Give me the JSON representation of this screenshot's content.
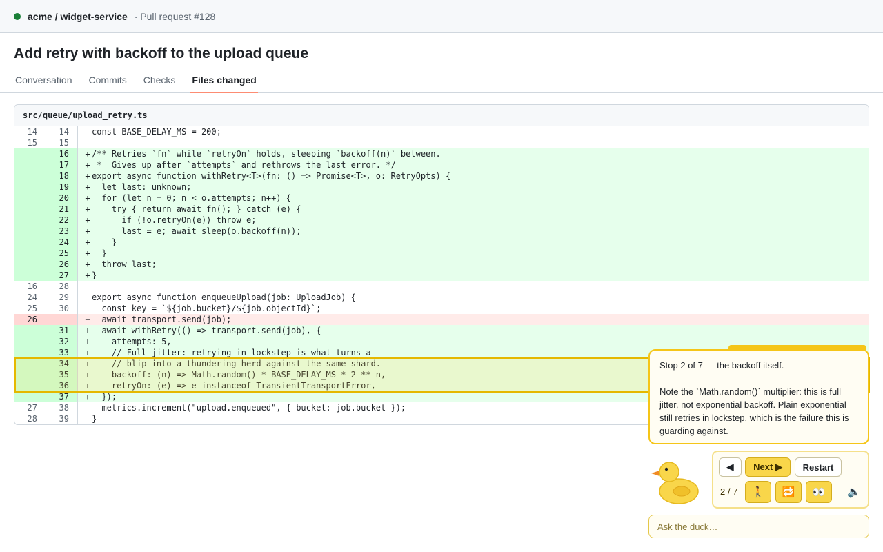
{
  "header": {
    "repo": "acme / widget-service",
    "pr_ref": "· Pull request #128",
    "status_color": "#1a7f37"
  },
  "pr_title": "Add retry with backoff to the upload queue",
  "tabs": [
    {
      "label": "Conversation",
      "active": false
    },
    {
      "label": "Commits",
      "active": false
    },
    {
      "label": "Checks",
      "active": false
    },
    {
      "label": "Files changed",
      "active": true
    }
  ],
  "file": {
    "path": "src/queue/upload_retry.ts",
    "lines": [
      {
        "type": "ctx",
        "old": "14",
        "new": "14",
        "sign": "",
        "code": "const BASE_DELAY_MS = 200;"
      },
      {
        "type": "ctx",
        "old": "15",
        "new": "15",
        "sign": "",
        "code": ""
      },
      {
        "type": "add",
        "old": "",
        "new": "16",
        "sign": "+",
        "code": "/** Retries `fn` while `retryOn` holds, sleeping `backoff(n)` between."
      },
      {
        "type": "add",
        "old": "",
        "new": "17",
        "sign": "+",
        "code": " *  Gives up after `attempts` and rethrows the last error. */"
      },
      {
        "type": "add",
        "old": "",
        "new": "18",
        "sign": "+",
        "code": "export async function withRetry<T>(fn: () => Promise<T>, o: RetryOpts) {"
      },
      {
        "type": "add",
        "old": "",
        "new": "19",
        "sign": "+",
        "code": "  let last: unknown;"
      },
      {
        "type": "add",
        "old": "",
        "new": "20",
        "sign": "+",
        "code": "  for (let n = 0; n < o.attempts; n++) {"
      },
      {
        "type": "add",
        "old": "",
        "new": "21",
        "sign": "+",
        "code": "    try { return await fn(); } catch (e) {"
      },
      {
        "type": "add",
        "old": "",
        "new": "22",
        "sign": "+",
        "code": "      if (!o.retryOn(e)) throw e;"
      },
      {
        "type": "add",
        "old": "",
        "new": "23",
        "sign": "+",
        "code": "      last = e; await sleep(o.backoff(n));"
      },
      {
        "type": "add",
        "old": "",
        "new": "24",
        "sign": "+",
        "code": "    }"
      },
      {
        "type": "add",
        "old": "",
        "new": "25",
        "sign": "+",
        "code": "  }"
      },
      {
        "type": "add",
        "old": "",
        "new": "26",
        "sign": "+",
        "code": "  throw last;"
      },
      {
        "type": "add",
        "old": "",
        "new": "27",
        "sign": "+",
        "code": "}"
      },
      {
        "type": "ctx",
        "old": "16",
        "new": "28",
        "sign": "",
        "code": ""
      },
      {
        "type": "ctx",
        "old": "24",
        "new": "29",
        "sign": "",
        "code": "export async function enqueueUpload(job: UploadJob) {"
      },
      {
        "type": "ctx",
        "old": "25",
        "new": "30",
        "sign": "",
        "code": "  const key = `${job.bucket}/${job.objectId}`;"
      },
      {
        "type": "del",
        "old": "26",
        "new": "",
        "sign": "−",
        "code": "  await transport.send(job);"
      },
      {
        "type": "add",
        "old": "",
        "new": "31",
        "sign": "+",
        "code": "  await withRetry(() => transport.send(job), {"
      },
      {
        "type": "add",
        "old": "",
        "new": "32",
        "sign": "+",
        "code": "    attempts: 5,"
      },
      {
        "type": "add",
        "old": "",
        "new": "33",
        "sign": "+",
        "code": "    // Full jitter: retrying in lockstep is what turns a"
      },
      {
        "type": "add",
        "old": "",
        "new": "34",
        "sign": "+",
        "code": "    // blip into a thundering herd against the same shard."
      },
      {
        "type": "add",
        "old": "",
        "new": "35",
        "sign": "+",
        "code": "    backoff: (n) => Math.random() * BASE_DELAY_MS * 2 ** n,"
      },
      {
        "type": "add",
        "old": "",
        "new": "36",
        "sign": "+",
        "code": "    retryOn: (e) => e instanceof TransientTransportError,"
      },
      {
        "type": "add",
        "old": "",
        "new": "37",
        "sign": "+",
        "code": "  });"
      },
      {
        "type": "ctx",
        "old": "27",
        "new": "38",
        "sign": "",
        "code": "  metrics.increment(\"upload.enqueued\", { bucket: job.bucket });"
      },
      {
        "type": "ctx",
        "old": "28",
        "new": "39",
        "sign": "",
        "code": "}"
      }
    ]
  },
  "tour": {
    "heading": "Stop 2 of 7 — the backoff itself.",
    "body": "Note the `Math.random()` multiplier: this is full jitter, not exponential backoff. Plain exponential still retries in lockstep, which is the failure this is guarding against.",
    "prev_label": "◀",
    "next_label": "Next ▶",
    "restart_label": "Restart",
    "counter": "2 / 7",
    "icon_person": "🚶",
    "icon_loop": "🔁",
    "icon_eyes": "👀",
    "icon_speaker": "🔈",
    "ask_placeholder": "Ask the duck…",
    "accent": "#f5c518"
  }
}
